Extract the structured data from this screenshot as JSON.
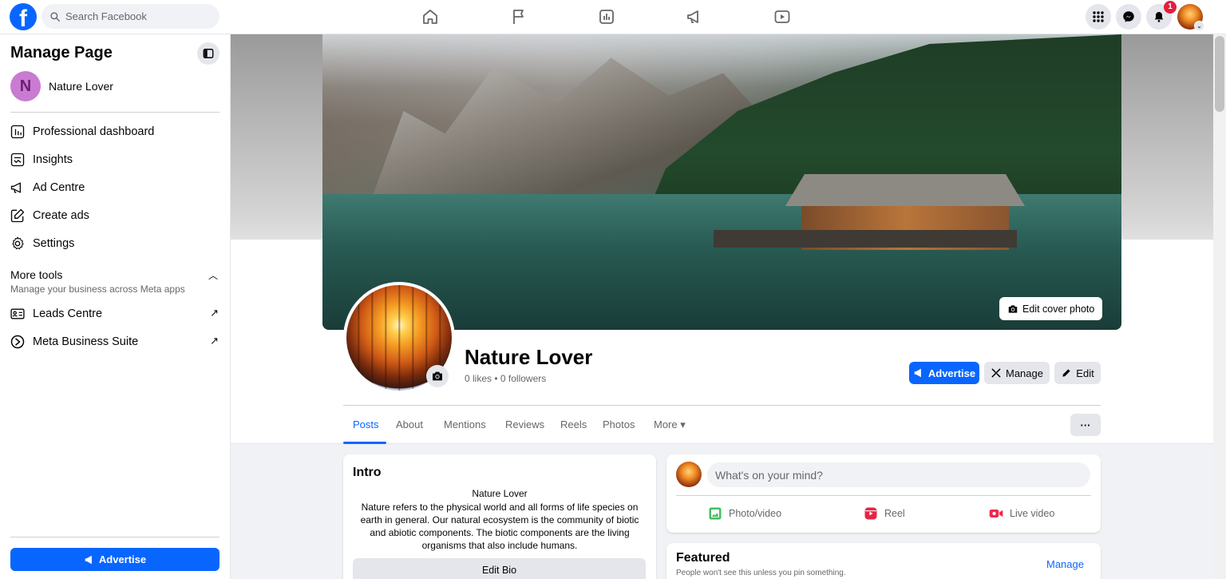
{
  "topbar": {
    "logo_letter": "f",
    "search_placeholder": "Search Facebook",
    "notification_count": "1",
    "nav_icons": [
      "home-icon",
      "flag-icon",
      "chart-icon",
      "megaphone-icon",
      "video-icon"
    ]
  },
  "sidebar": {
    "title": "Manage Page",
    "page_initial": "N",
    "page_name": "Nature Lover",
    "items": [
      {
        "label": "Professional dashboard",
        "icon": "dashboard-icon"
      },
      {
        "label": "Insights",
        "icon": "insights-icon"
      },
      {
        "label": "Ad Centre",
        "icon": "megaphone-icon"
      },
      {
        "label": "Create ads",
        "icon": "edit-icon"
      },
      {
        "label": "Settings",
        "icon": "gear-icon"
      }
    ],
    "more_tools": {
      "title": "More tools",
      "subtitle": "Manage your business across Meta apps",
      "items": [
        {
          "label": "Leads Centre",
          "icon": "id-card-icon"
        },
        {
          "label": "Meta Business Suite",
          "icon": "meta-suite-icon"
        }
      ]
    },
    "advertise_label": "Advertise"
  },
  "profile": {
    "edit_cover_label": "Edit cover photo",
    "name": "Nature Lover",
    "stats": "0 likes • 0 followers",
    "advertise_label": "Advertise",
    "manage_label": "Manage",
    "edit_label": "Edit"
  },
  "tabs": [
    "Posts",
    "About",
    "Mentions",
    "Reviews",
    "Reels",
    "Photos",
    "More ▾"
  ],
  "intro": {
    "title": "Intro",
    "name": "Nature Lover",
    "bio": "Nature refers to the physical world and all forms of life species on earth in general. Our natural ecosystem is the community of biotic and abiotic components. The biotic components are the living organisms that also include humans.",
    "edit_bio_label": "Edit Bio"
  },
  "composer": {
    "placeholder": "What's on your mind?",
    "actions": [
      "Photo/video",
      "Reel",
      "Live video"
    ]
  },
  "featured": {
    "title": "Featured",
    "subtitle": "People won't see this unless you pin something.",
    "manage_label": "Manage"
  },
  "colors": {
    "brand": "#0866ff",
    "photo_green": "#45bd62",
    "reel_pink": "#e42645",
    "live_red": "#f02849"
  }
}
